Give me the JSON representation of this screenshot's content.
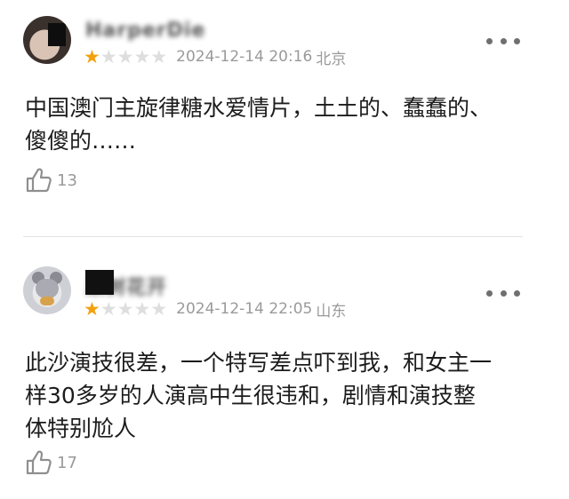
{
  "reviews": [
    {
      "username": "HarperDie",
      "rating": 1,
      "max_rating": 5,
      "time": "2024-12-14 20:16",
      "location": "北京",
      "content": "中国澳门主旋律糖水爱情片，土土的、蠢蠢的、\n傻傻的……",
      "likes": "13"
    },
    {
      "username": "果树花开",
      "rating": 1,
      "max_rating": 5,
      "time": "2024-12-14 22:05",
      "location": "山东",
      "content": "此沙演技很差，一个特写差点吓到我，和女主一\n样30多岁的人演高中生很违和，剧情和演技整\n体特别尬人",
      "likes": "17"
    }
  ],
  "colors": {
    "star_on": "#f2a10d",
    "star_off": "#dedede",
    "meta_text": "#9a9a9a"
  },
  "icons": {
    "more": "more-dots-icon",
    "like": "thumbs-up-icon",
    "star": "star-icon"
  }
}
